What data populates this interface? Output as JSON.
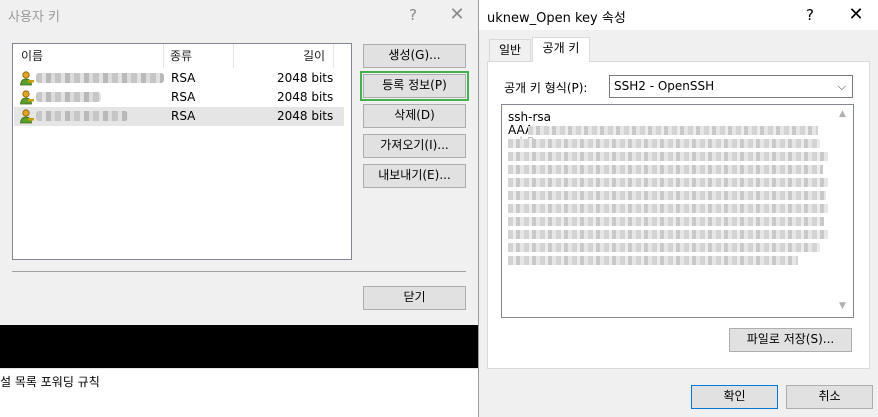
{
  "left_dialog": {
    "title": "사용자 키",
    "help_glyph": "?",
    "close_glyph": "✕",
    "columns": {
      "name": "이름",
      "type": "종류",
      "length": "길이"
    },
    "rows": [
      {
        "type": "RSA",
        "length": "2048 bits"
      },
      {
        "type": "RSA",
        "length": "2048 bits"
      },
      {
        "type": "RSA",
        "length": "2048 bits"
      }
    ],
    "buttons": {
      "generate": "생성(G)...",
      "info": "등록 정보(P)",
      "delete": "삭제(D)",
      "import": "가져오기(I)...",
      "export": "내보내기(E)...",
      "close": "닫기"
    }
  },
  "bottom_tabs": "설 목록   포워딩 규칙",
  "right_dialog": {
    "title": "uknew_Open key 속성",
    "help_glyph": "?",
    "close_glyph": "✕",
    "tabs": [
      "일반",
      "공개 키"
    ],
    "format_label": "공개 키 형식(P):",
    "format_value": "SSH2 - OpenSSH",
    "key_lines": [
      "ssh-rsa",
      "AAA",
      "...bP"
    ],
    "save_button": "파일로 저장(S)...",
    "ok_button": "확인",
    "cancel_button": "취소"
  },
  "colors": {
    "highlight_outline": "#46b04f",
    "selected_row": "#e5e5e5",
    "default_button_border": "#0078d7"
  },
  "icons": {
    "user_key": "user-key-icon",
    "dropdown": "chevron-down-icon"
  }
}
